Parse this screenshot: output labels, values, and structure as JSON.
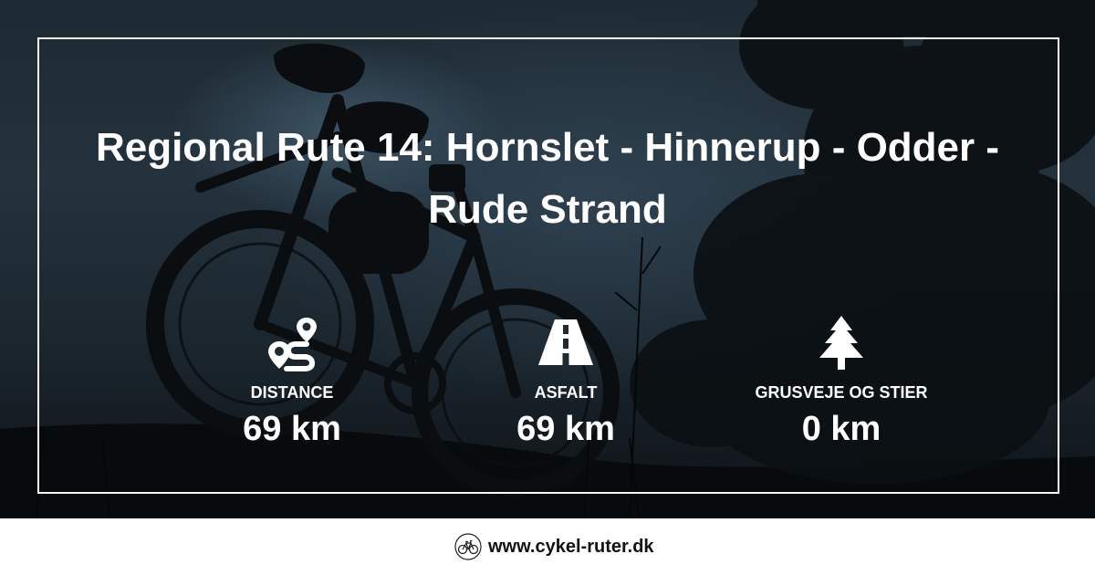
{
  "title": "Regional Rute 14: Hornslet - Hinnerup - Odder - Rude Strand",
  "stats": [
    {
      "icon": "route-icon",
      "label": "DISTANCE",
      "value": "69 km"
    },
    {
      "icon": "road-icon",
      "label": "ASFALT",
      "value": "69 km"
    },
    {
      "icon": "tree-icon",
      "label": "GRUSVEJE OG STIER",
      "value": "0 km"
    }
  ],
  "footer": {
    "logo_icon": "bicycle-icon",
    "site": "www.cykel-ruter.dk"
  },
  "colors": {
    "text": "#ffffff",
    "footer_text": "#111111",
    "sky": "#24323d"
  }
}
